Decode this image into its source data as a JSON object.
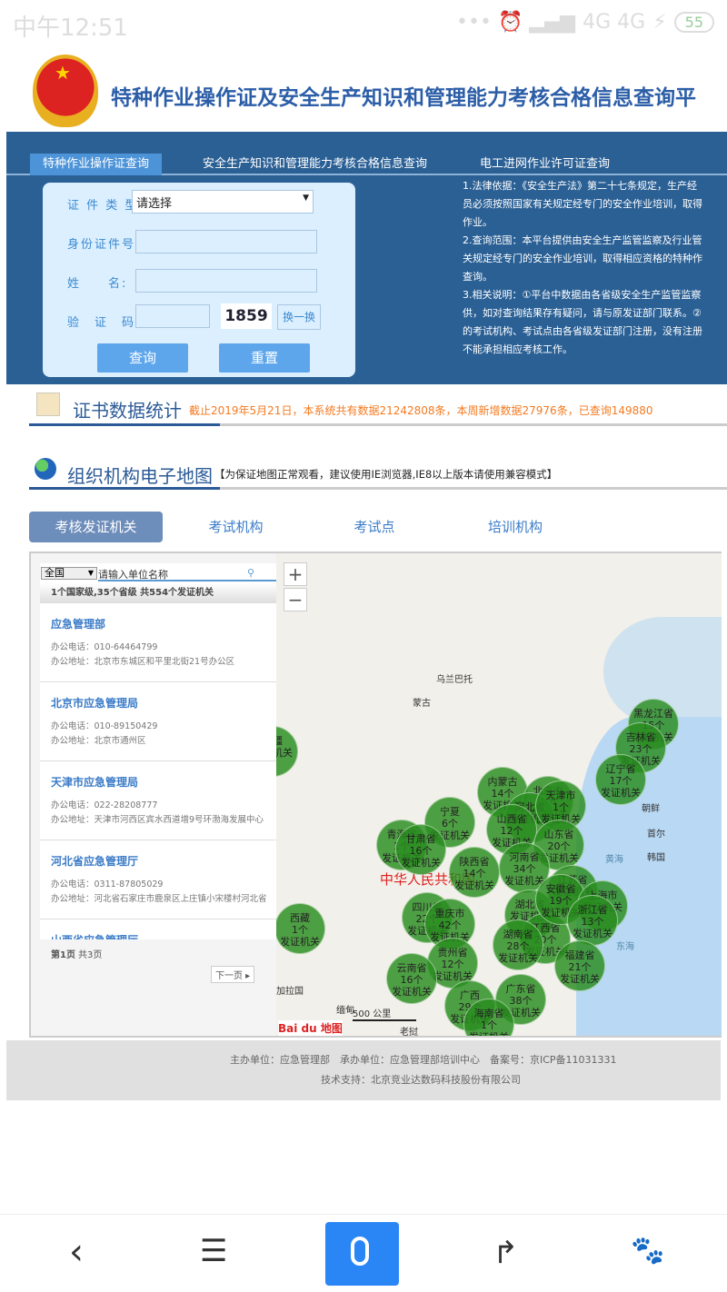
{
  "status_bar": {
    "time": "中午12:51",
    "network": "4G 4G",
    "battery": "55"
  },
  "header": {
    "title": "特种作业操作证及安全生产知识和管理能力考核合格信息查询平"
  },
  "query": {
    "tabs": [
      {
        "label": "特种作业操作证查询"
      },
      {
        "label": "安全生产知识和管理能力考核合格信息查询"
      },
      {
        "label": "电工进网作业许可证查询"
      }
    ],
    "form": {
      "cert_type_label": "证 件 类 型:",
      "cert_type_value": "请选择",
      "id_label": "身份证件号:",
      "name_label": "姓　　名:",
      "captcha_label": "验　证　码:",
      "captcha_image": "1859",
      "refresh_label": "换一换",
      "submit_label": "查询",
      "reset_label": "重置"
    },
    "notes": [
      "1.法律依据：《安全生产法》第二十七条规定，生产经",
      "员必须按照国家有关规定经专门的安全作业培训，取得",
      "作业。",
      "2.查询范围：本平台提供由安全生产监管监察及行业管",
      "关规定经专门的安全作业培训，取得相应资格的特种作",
      "查询。",
      "3.相关说明：①平台中数据由各省级安全生产监管监察",
      "供，如对查询结果存有疑问，请与原发证部门联系。②",
      "的考试机构、考试点由各省级发证部门注册，没有注册",
      "不能承担相应考核工作。"
    ]
  },
  "stats": {
    "title": "证书数据统计",
    "text": "截止2019年5月21日，本系统共有数据21242808条，本周新增数据27976条，已查询149880"
  },
  "mapsec": {
    "title": "组织机构电子地图",
    "note": "【为保证地图正常观看，建议使用IE浏览器,IE8以上版本请使用兼容模式】",
    "tabs": [
      {
        "label": "考核发证机关"
      },
      {
        "label": "考试机构"
      },
      {
        "label": "考试点"
      },
      {
        "label": "培训机构"
      }
    ]
  },
  "list": {
    "region": "全国",
    "search_placeholder": "请输入单位名称",
    "summary": "1个国家级,35个省级  共554个发证机关",
    "items": [
      {
        "name": "应急管理部",
        "phone": "办公电话：010-64464799",
        "address": "办公地址：北京市东城区和平里北街21号办公区"
      },
      {
        "name": "北京市应急管理局",
        "phone": "办公电话：010-89150429",
        "address": "办公地址：北京市通州区"
      },
      {
        "name": "天津市应急管理局",
        "phone": "办公电话：022-28208777",
        "address": "办公地址：天津市河西区宾水西道增9号环渤海发展中心"
      },
      {
        "name": "河北省应急管理厅",
        "phone": "办公电话：0311-87805029",
        "address": "办公地址：河北省石家庄市鹿泉区上庄镇小宋楼村河北省"
      },
      {
        "name": "山西省应急管理厅",
        "phone": "",
        "address": ""
      }
    ],
    "page": "第1页",
    "total": "共3页",
    "next": "下一页"
  },
  "map": {
    "labels": {
      "mongolia": "蒙古",
      "ulaanbaatar": "乌兰巴托",
      "china": "中华人民共和国",
      "dprk": "朝鲜",
      "seoul": "首尔",
      "korea": "韩国",
      "yellow_sea": "黄海",
      "east_sea": "东海",
      "myanmar": "缅甸",
      "bangladesh": "加拉国",
      "laos": "老挝",
      "scale": "500 公里",
      "logo": "Bai du 地图"
    },
    "cluster_suffix": "发证机关",
    "clusters": [
      {
        "name": "黑龙江省",
        "count": "15个"
      },
      {
        "name": "吉林省",
        "count": "23个"
      },
      {
        "name": "辽宁省",
        "count": "17个"
      },
      {
        "name": "内蒙古",
        "count": "14个"
      },
      {
        "name": "北京市",
        "count": "1个"
      },
      {
        "name": "河北省",
        "count": ""
      },
      {
        "name": "天津市",
        "count": "1个"
      },
      {
        "name": "山西省",
        "count": "12个"
      },
      {
        "name": "山东省",
        "count": "20个"
      },
      {
        "name": "河南省",
        "count": "34个"
      },
      {
        "name": "宁夏",
        "count": "6个"
      },
      {
        "name": "青海省",
        "count": "1个"
      },
      {
        "name": "甘肃省",
        "count": "16个"
      },
      {
        "name": "陕西省",
        "count": "14个"
      },
      {
        "name": "四川省",
        "count": "22个"
      },
      {
        "name": "重庆市",
        "count": "42个"
      },
      {
        "name": "西藏",
        "count": "1个"
      },
      {
        "name": "贵州省",
        "count": "12个"
      },
      {
        "name": "云南省",
        "count": "16个"
      },
      {
        "name": "广西",
        "count": "29个"
      },
      {
        "name": "广东省",
        "count": "38个"
      },
      {
        "name": "海南省",
        "count": "1个"
      },
      {
        "name": "湖北省",
        "count": ""
      },
      {
        "name": "江西省",
        "count": "20个"
      },
      {
        "name": "湖南省",
        "count": "28个"
      },
      {
        "name": "江苏省",
        "count": ""
      },
      {
        "name": "安徽省",
        "count": "19个"
      },
      {
        "name": "上海市",
        "count": ""
      },
      {
        "name": "浙江省",
        "count": "13个"
      },
      {
        "name": "福建省",
        "count": "21个"
      },
      {
        "name": "新疆",
        "count": ""
      }
    ]
  },
  "footer": {
    "line1": "主办单位：应急管理部　承办单位：应急管理部培训中心　备案号：京ICP备11031331",
    "line2": "技术支持：北京竞业达数码科技股份有限公司"
  },
  "colors": {
    "header_blue": "#2b6095",
    "accent": "#4c93d8",
    "cluster_green": "#2e8c1e",
    "stats_orange": "#f47a20",
    "voice_button": "#2b86f5"
  }
}
